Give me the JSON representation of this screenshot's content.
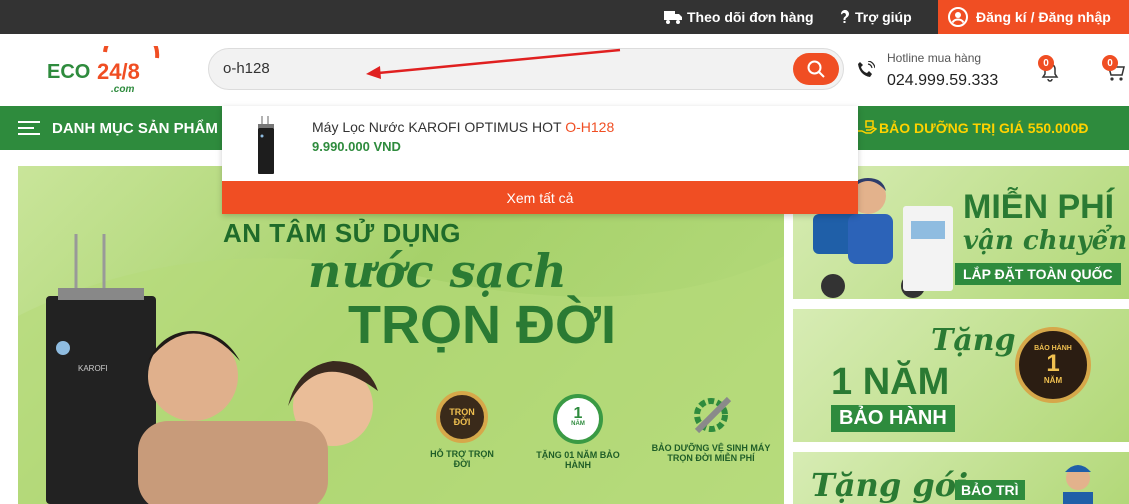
{
  "topbar": {
    "track_order": "Theo dõi đơn hàng",
    "help": "Trợ giúp",
    "register": "Đăng kí",
    "separator": "/",
    "login": "Đăng nhập"
  },
  "header": {
    "logo_text": "ECO",
    "logo_number": "24/8",
    "logo_domain": ".com",
    "search_value": "o-h128",
    "hotline_label": "Hotline mua hàng",
    "hotline_number": "024.999.59.333",
    "notification_count": "0",
    "cart_count": "0"
  },
  "nav": {
    "menu_label": "DANH MỤC SẢN PHẨM",
    "promo": "BẢO DƯỠNG TRỊ GIÁ 550.000Đ"
  },
  "dropdown": {
    "item_name_prefix": "Máy Lọc Nước KAROFI OPTIMUS HOT",
    "item_name_highlight": "O-H128",
    "item_price": "9.990.000 VND",
    "view_all": "Xem tất cả"
  },
  "hero": {
    "line1": "AN TÂM SỬ DỤNG",
    "line2": "nước sạch",
    "line3": "TRỌN ĐỜI",
    "badge1_icon_text": "TRỌN ĐỜI",
    "badge1": "HỖ TRỢ TRỌN ĐỜI",
    "badge2_icon_text": "1",
    "badge2_icon_unit": "NĂM",
    "badge2": "TẶNG 01 NĂM BẢO HÀNH",
    "badge3_line1": "BẢO DƯỠNG VỆ SINH MÁY",
    "badge3_line2": "TRỌN ĐỜI MIỄN PHÍ",
    "product_brand": "KAROFI"
  },
  "side_banners": {
    "b1_line1": "MIỄN PHÍ",
    "b1_line2": "vận chuyển",
    "b1_line3": "LẮP ĐẶT TOÀN QUỐC",
    "b2_line1": "Tặng",
    "b2_line2": "1 NĂM",
    "b2_line3": "BẢO HÀNH",
    "b2_seal_top": "BẢO HÀNH",
    "b2_seal_num": "1",
    "b2_seal_unit": "NĂM",
    "b3_line1": "Tặng gói",
    "b3_line2": "BẢO TRÌ"
  },
  "colors": {
    "accent": "#f04e23",
    "green": "#2e8b3d",
    "topbar": "#333333",
    "promo": "#ffd200"
  }
}
